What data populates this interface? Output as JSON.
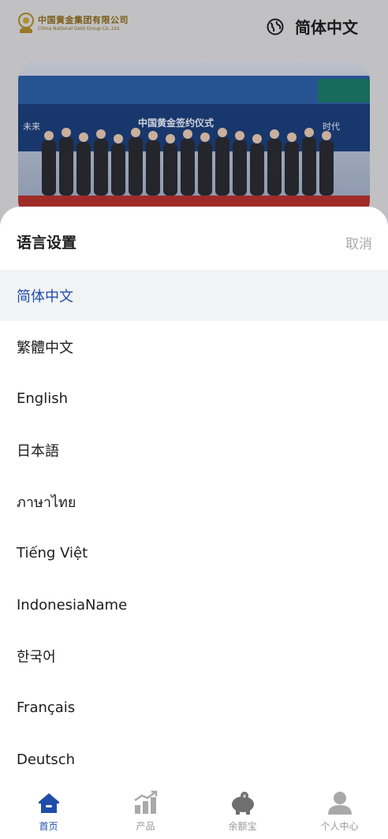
{
  "header": {
    "logo_cn": "中国黄金集团有限公司",
    "logo_en": "China National Gold Group Co.,Ltd.",
    "current_language": "简体中文"
  },
  "banner": {
    "headline": "中国黄金签约仪式",
    "left_word": "未来",
    "right_word": "时代"
  },
  "sheet": {
    "title": "语言设置",
    "cancel_label": "取消",
    "languages": [
      {
        "label": "简体中文",
        "active": true
      },
      {
        "label": "繁體中文",
        "active": false
      },
      {
        "label": "English",
        "active": false
      },
      {
        "label": "日本語",
        "active": false
      },
      {
        "label": "ภาษาไทย",
        "active": false
      },
      {
        "label": "Tiếng Việt",
        "active": false
      },
      {
        "label": "IndonesiaName",
        "active": false
      },
      {
        "label": "한국어",
        "active": false
      },
      {
        "label": "Français",
        "active": false
      },
      {
        "label": "Deutsch",
        "active": false
      }
    ]
  },
  "tabbar": {
    "items": [
      {
        "label": "首页",
        "icon": "home-icon",
        "active": true
      },
      {
        "label": "产品",
        "icon": "chart-icon",
        "active": false
      },
      {
        "label": "余额宝",
        "icon": "piggy-bank-icon",
        "active": false
      },
      {
        "label": "个人中心",
        "icon": "user-icon",
        "active": false
      }
    ]
  },
  "colors": {
    "accent": "#1f4ea8",
    "active_row_bg": "#f2f3f5",
    "muted": "#a9a9a9",
    "brand_gold": "#8a6a1c"
  }
}
